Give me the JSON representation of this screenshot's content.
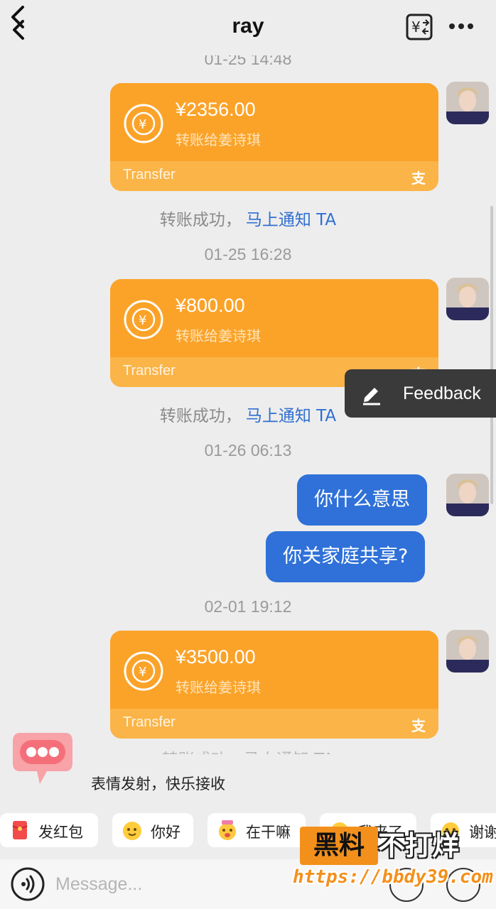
{
  "header": {
    "title": "ray",
    "back_icon": "chevron-left-icon",
    "transfer_icon": "yuan-transfer-icon",
    "more_icon": "more-dots-icon"
  },
  "messages": {
    "ts0": "01-25 14:48",
    "card1": {
      "amount": "¥2356.00",
      "recipient": "转账给姜诗琪",
      "label": "Transfer",
      "brand": "支"
    },
    "notice1": {
      "text": "转账成功，",
      "link": "马上通知 TA"
    },
    "ts1": "01-25 16:28",
    "card2": {
      "amount": "¥800.00",
      "recipient": "转账给姜诗琪",
      "label": "Transfer",
      "brand": "支"
    },
    "notice2": {
      "text": "转账成功，",
      "link": "马上通知 TA"
    },
    "ts2": "01-26 06:13",
    "bubble1": "你什么意思",
    "bubble2": "你关家庭共享?",
    "ts3": "02-01 19:12",
    "card3": {
      "amount": "¥3500.00",
      "recipient": "转账给姜诗琪",
      "label": "Transfer",
      "brand": "支"
    },
    "notice3_peek": "转账成功，马上通知 TA"
  },
  "feedback": {
    "label": "Feedback",
    "icon": "edit-pencil-icon"
  },
  "emoji_promo": {
    "text": "表情发射，快乐接收",
    "icon": "chat-bubble-dots-icon"
  },
  "quick_replies": [
    {
      "label": "发红包",
      "icon": "red-envelope-icon"
    },
    {
      "label": "你好",
      "icon": "wave-emoji-icon"
    },
    {
      "label": "在干嘛",
      "icon": "thinking-emoji-icon"
    },
    {
      "label": "我来了",
      "icon": "running-emoji-icon"
    },
    {
      "label": "谢谢",
      "icon": "thanks-emoji-icon"
    }
  ],
  "input": {
    "placeholder": "Message...",
    "voice_icon": "voice-icon"
  },
  "watermark": {
    "word1": "黑料",
    "word2": "不打烊",
    "url": "https://bbdy39.com"
  },
  "colors": {
    "card": "#fba329",
    "bubble": "#2f71d8",
    "link": "#2f6fd1"
  }
}
